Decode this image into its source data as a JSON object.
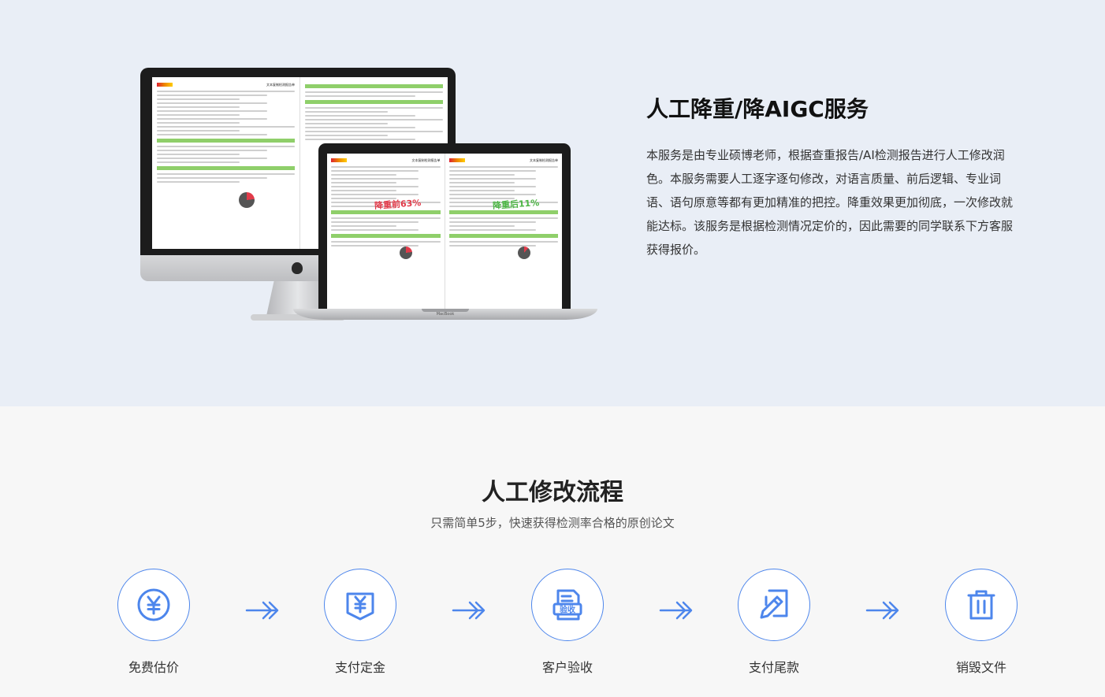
{
  "hero": {
    "title": "人工降重/降AIGC服务",
    "description": "本服务是由专业硕博老师，根据查重报告/AI检测报告进行人工修改润色。本服务需要人工逐字逐句修改，对语言质量、前后逻辑、专业词语、语句原意等都有更加精准的把控。降重效果更加彻底，一次修改就能达标。该服务是根据检测情况定价的，因此需要的同学联系下方客服获得报价。"
  },
  "devices": {
    "report_title": "文本复制检测报告单",
    "before_label": "降重前63%",
    "after_label": "降重后11%",
    "laptop_brand": "MacBook"
  },
  "flow": {
    "title": "人工修改流程",
    "subtitle": "只需简单5步，快速获得检测率合格的原创论文",
    "steps": [
      {
        "label": "免费估价",
        "icon": "yen-circle-icon"
      },
      {
        "label": "支付定金",
        "icon": "yen-document-icon"
      },
      {
        "label": "客户验收",
        "icon": "acceptance-document-icon",
        "icon_text": "验收"
      },
      {
        "label": "支付尾款",
        "icon": "edit-document-icon"
      },
      {
        "label": "销毁文件",
        "icon": "trash-icon"
      }
    ],
    "accent_color": "#4d86ec"
  }
}
